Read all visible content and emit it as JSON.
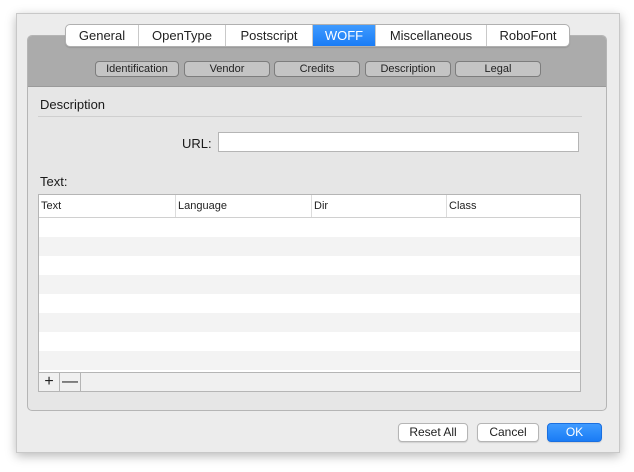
{
  "tabs": [
    {
      "label": "General"
    },
    {
      "label": "OpenType"
    },
    {
      "label": "Postscript"
    },
    {
      "label": "WOFF",
      "active": true
    },
    {
      "label": "Miscellaneous"
    },
    {
      "label": "RoboFont"
    }
  ],
  "subtabs": [
    {
      "label": "Identification"
    },
    {
      "label": "Vendor"
    },
    {
      "label": "Credits"
    },
    {
      "label": "Description"
    },
    {
      "label": "Legal"
    }
  ],
  "section": {
    "title": "Description"
  },
  "url": {
    "label": "URL:",
    "value": ""
  },
  "text_table": {
    "label": "Text:",
    "columns": [
      "Text",
      "Language",
      "Dir",
      "Class"
    ],
    "add_label": "+",
    "remove_label": "—"
  },
  "buttons": {
    "reset": "Reset All",
    "cancel": "Cancel",
    "ok": "OK"
  },
  "colors": {
    "accent": "#1a7cf5",
    "header": "#ababab",
    "window": "#ececec"
  }
}
